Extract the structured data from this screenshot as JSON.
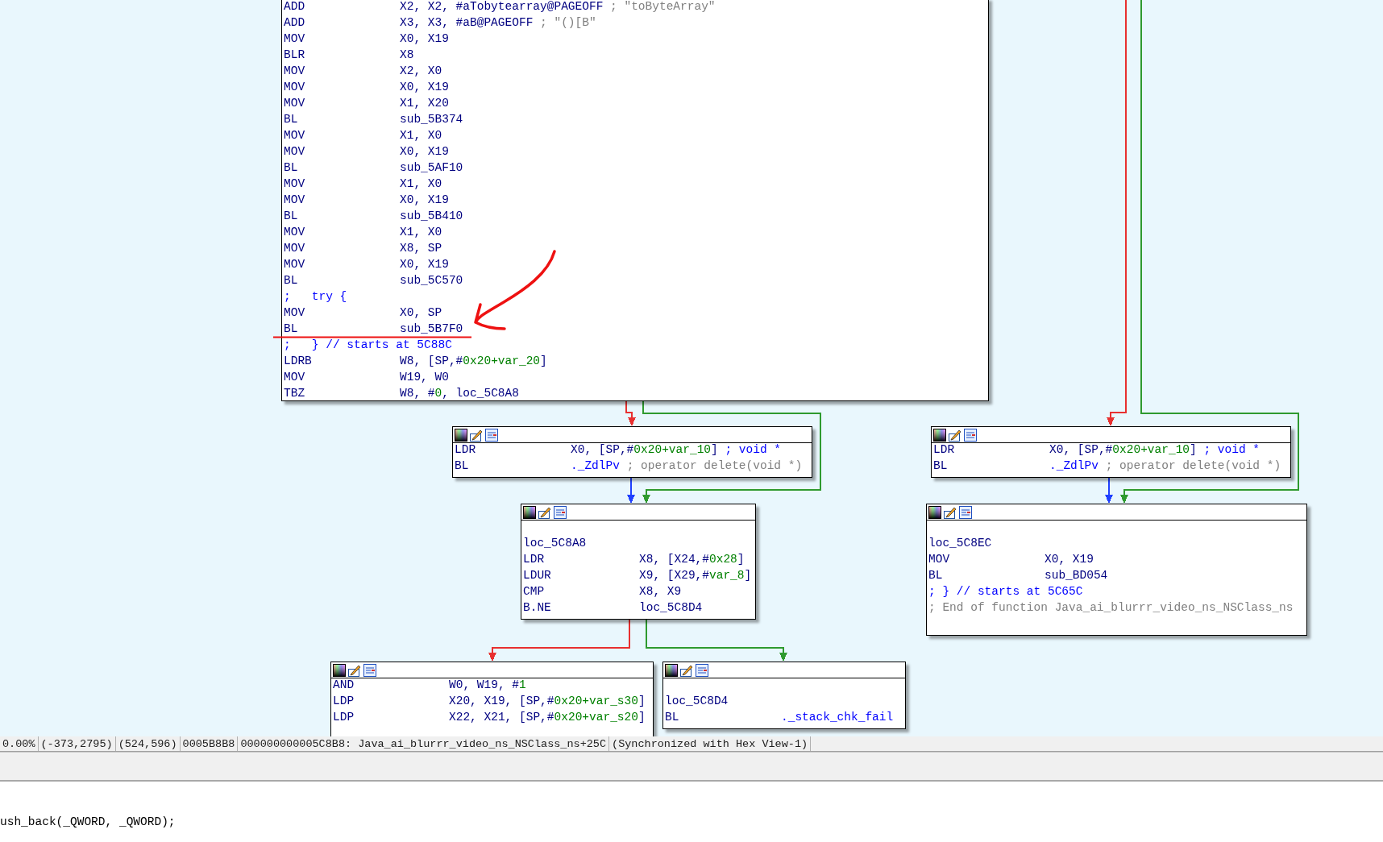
{
  "graph": {
    "blocks": [
      {
        "lines": [
          {
            "kind": "insn",
            "mnemonic": "ADD",
            "operands": [
              {
                "text": "X2, X2, #aTobytearray@PAGEOFF ",
                "kind": "plain"
              },
              {
                "text": "; \"toByteArray\"",
                "kind": "comment"
              }
            ]
          },
          {
            "kind": "insn",
            "mnemonic": "ADD",
            "operands": [
              {
                "text": "X3, X3, #aB@PAGEOFF ",
                "kind": "plain"
              },
              {
                "text": "; \"()[B\"",
                "kind": "comment"
              }
            ]
          },
          {
            "kind": "insn",
            "mnemonic": "MOV",
            "operands": [
              {
                "text": "X0, X19",
                "kind": "plain"
              }
            ]
          },
          {
            "kind": "insn",
            "mnemonic": "BLR",
            "operands": [
              {
                "text": "X8",
                "kind": "plain"
              }
            ]
          },
          {
            "kind": "insn",
            "mnemonic": "MOV",
            "operands": [
              {
                "text": "X2, X0",
                "kind": "plain"
              }
            ]
          },
          {
            "kind": "insn",
            "mnemonic": "MOV",
            "operands": [
              {
                "text": "X0, X19",
                "kind": "plain"
              }
            ]
          },
          {
            "kind": "insn",
            "mnemonic": "MOV",
            "operands": [
              {
                "text": "X1, X20",
                "kind": "plain"
              }
            ]
          },
          {
            "kind": "insn",
            "mnemonic": "BL",
            "operands": [
              {
                "text": "sub_5B374",
                "kind": "plain"
              }
            ]
          },
          {
            "kind": "insn",
            "mnemonic": "MOV",
            "operands": [
              {
                "text": "X1, X0",
                "kind": "plain"
              }
            ]
          },
          {
            "kind": "insn",
            "mnemonic": "MOV",
            "operands": [
              {
                "text": "X0, X19",
                "kind": "plain"
              }
            ]
          },
          {
            "kind": "insn",
            "mnemonic": "BL",
            "operands": [
              {
                "text": "sub_5AF10",
                "kind": "plain"
              }
            ]
          },
          {
            "kind": "insn",
            "mnemonic": "MOV",
            "operands": [
              {
                "text": "X1, X0",
                "kind": "plain"
              }
            ]
          },
          {
            "kind": "insn",
            "mnemonic": "MOV",
            "operands": [
              {
                "text": "X0, X19",
                "kind": "plain"
              }
            ]
          },
          {
            "kind": "insn",
            "mnemonic": "BL",
            "operands": [
              {
                "text": "sub_5B410",
                "kind": "plain"
              }
            ]
          },
          {
            "kind": "insn",
            "mnemonic": "MOV",
            "operands": [
              {
                "text": "X1, X0",
                "kind": "plain"
              }
            ]
          },
          {
            "kind": "insn",
            "mnemonic": "MOV",
            "operands": [
              {
                "text": "X8, SP",
                "kind": "plain"
              }
            ]
          },
          {
            "kind": "insn",
            "mnemonic": "MOV",
            "operands": [
              {
                "text": "X0, X19",
                "kind": "plain"
              }
            ]
          },
          {
            "kind": "insn",
            "mnemonic": "BL",
            "operands": [
              {
                "text": "sub_5C570",
                "kind": "plain"
              }
            ]
          },
          {
            "kind": "note",
            "text": ";   try {"
          },
          {
            "kind": "insn",
            "mnemonic": "MOV",
            "operands": [
              {
                "text": "X0, SP",
                "kind": "plain"
              }
            ]
          },
          {
            "kind": "insn",
            "mnemonic": "BL",
            "operands": [
              {
                "text": "sub_5B7F0",
                "kind": "plain"
              }
            ]
          },
          {
            "kind": "note",
            "text": ";   } // starts at 5C88C"
          },
          {
            "kind": "insn",
            "mnemonic": "LDRB",
            "operands": [
              {
                "text": "W8, [SP,#",
                "kind": "plain"
              },
              {
                "text": "0x20+var_20",
                "kind": "number"
              },
              {
                "text": "]",
                "kind": "plain"
              }
            ]
          },
          {
            "kind": "insn",
            "mnemonic": "MOV",
            "operands": [
              {
                "text": "W19, W0",
                "kind": "plain"
              }
            ]
          },
          {
            "kind": "insn",
            "mnemonic": "TBZ",
            "operands": [
              {
                "text": "W8, #",
                "kind": "plain"
              },
              {
                "text": "0",
                "kind": "number"
              },
              {
                "text": ", loc_5C8A8",
                "kind": "plain"
              }
            ]
          }
        ]
      },
      {
        "lines": [
          {
            "kind": "insn",
            "mnemonic": "LDR",
            "operands": [
              {
                "text": "X0, [SP,#",
                "kind": "plain"
              },
              {
                "text": "0x20+var_10",
                "kind": "number"
              },
              {
                "text": "] ",
                "kind": "plain"
              },
              {
                "text": "; void *",
                "kind": "name"
              }
            ]
          },
          {
            "kind": "insn",
            "mnemonic": "BL",
            "operands": [
              {
                "text": "._ZdlPv ",
                "kind": "name"
              },
              {
                "text": "; operator delete(void *)",
                "kind": "comment"
              }
            ]
          }
        ]
      },
      {
        "lines": [
          {
            "kind": "insn",
            "mnemonic": "LDR",
            "operands": [
              {
                "text": "X0, [SP,#",
                "kind": "plain"
              },
              {
                "text": "0x20+var_10",
                "kind": "number"
              },
              {
                "text": "] ",
                "kind": "plain"
              },
              {
                "text": "; void *",
                "kind": "name"
              }
            ]
          },
          {
            "kind": "insn",
            "mnemonic": "BL",
            "operands": [
              {
                "text": "._ZdlPv ",
                "kind": "name"
              },
              {
                "text": "; operator delete(void *)",
                "kind": "comment"
              }
            ]
          }
        ]
      },
      {
        "lines": [
          {
            "kind": "blank"
          },
          {
            "kind": "label",
            "text": "loc_5C8A8"
          },
          {
            "kind": "insn",
            "mnemonic": "LDR",
            "operands": [
              {
                "text": "X8, [X24,#",
                "kind": "plain"
              },
              {
                "text": "0x28",
                "kind": "number"
              },
              {
                "text": "]",
                "kind": "plain"
              }
            ]
          },
          {
            "kind": "insn",
            "mnemonic": "LDUR",
            "operands": [
              {
                "text": "X9, [X29,#",
                "kind": "plain"
              },
              {
                "text": "var_8",
                "kind": "number"
              },
              {
                "text": "]",
                "kind": "plain"
              }
            ]
          },
          {
            "kind": "insn",
            "mnemonic": "CMP",
            "operands": [
              {
                "text": "X8, X9",
                "kind": "plain"
              }
            ]
          },
          {
            "kind": "insn",
            "mnemonic": "B.NE",
            "operands": [
              {
                "text": "loc_5C8D4",
                "kind": "plain"
              }
            ]
          }
        ]
      },
      {
        "lines": [
          {
            "kind": "blank"
          },
          {
            "kind": "label",
            "text": "loc_5C8EC"
          },
          {
            "kind": "insn",
            "mnemonic": "MOV",
            "operands": [
              {
                "text": "X0, X19",
                "kind": "plain"
              }
            ]
          },
          {
            "kind": "insn",
            "mnemonic": "BL",
            "operands": [
              {
                "text": "sub_BD054",
                "kind": "plain"
              }
            ]
          },
          {
            "kind": "note",
            "text": "; } // starts at 5C65C"
          },
          {
            "kind": "gray_note",
            "text": "; End of function Java_ai_blurrr_video_ns_NSClass_ns"
          }
        ]
      },
      {
        "lines": [
          {
            "kind": "insn",
            "mnemonic": "AND",
            "operands": [
              {
                "text": "W0, W19, #",
                "kind": "plain"
              },
              {
                "text": "1",
                "kind": "number"
              }
            ]
          },
          {
            "kind": "insn",
            "mnemonic": "LDP",
            "operands": [
              {
                "text": "X20, X19, [SP,#",
                "kind": "plain"
              },
              {
                "text": "0x20+var_s30",
                "kind": "number"
              },
              {
                "text": "]",
                "kind": "plain"
              }
            ]
          },
          {
            "kind": "insn",
            "mnemonic": "LDP",
            "operands": [
              {
                "text": "X22, X21, [SP,#",
                "kind": "plain"
              },
              {
                "text": "0x20+var_s20",
                "kind": "number"
              },
              {
                "text": "]",
                "kind": "plain"
              }
            ]
          }
        ]
      },
      {
        "lines": [
          {
            "kind": "blank"
          },
          {
            "kind": "label",
            "text": "loc_5C8D4"
          },
          {
            "kind": "insn",
            "mnemonic": "BL",
            "operands": [
              {
                "text": "._stack_chk_fail",
                "kind": "name"
              }
            ]
          }
        ]
      }
    ],
    "edges": [
      {
        "color": "#e83030"
      },
      {
        "color": "#2f9a2f"
      },
      {
        "color": "#e83030"
      },
      {
        "color": "#2f9a2f"
      },
      {
        "color": "#2040ff"
      },
      {
        "color": "#2040ff"
      },
      {
        "color": "#e83030"
      },
      {
        "color": "#2f9a2f"
      }
    ]
  },
  "status_bar": [
    "0.00%",
    "(-373,2795)",
    "(524,596)",
    "0005B8B8",
    "000000000005C8B8: Java_ai_blurrr_video_ns_NSClass_ns+25C",
    "(Synchronized with Hex View-1)"
  ],
  "pseudocode": {
    "lines": [
      "ush_back(_QWORD, _QWORD);"
    ]
  }
}
